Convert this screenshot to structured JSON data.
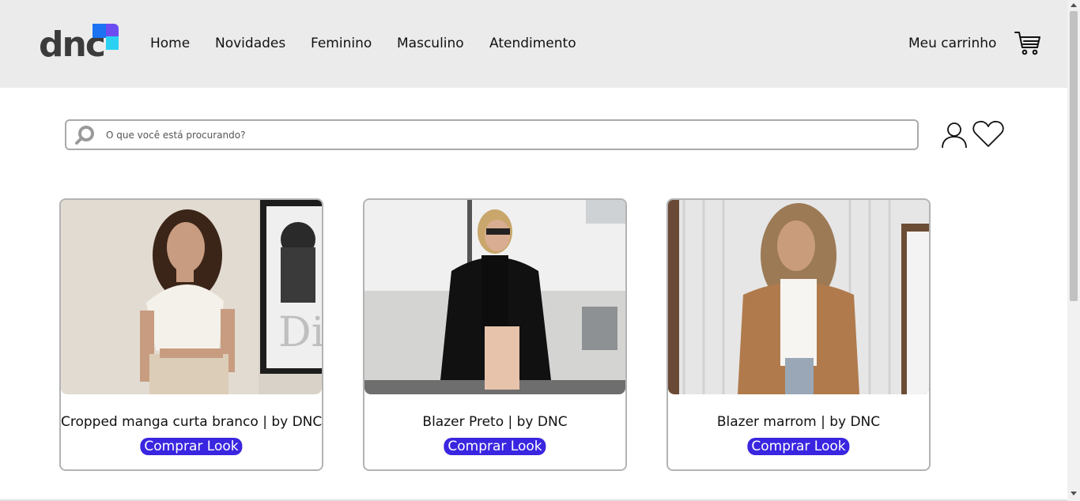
{
  "brand": {
    "logo_text": "dnc",
    "colors": {
      "blue": "#1b73f2",
      "purple": "#6d4df2",
      "cyan": "#2bd1f2"
    }
  },
  "nav": {
    "items": [
      {
        "label": "Home"
      },
      {
        "label": "Novidades"
      },
      {
        "label": "Feminino"
      },
      {
        "label": "Masculino"
      },
      {
        "label": "Atendimento"
      }
    ]
  },
  "cart": {
    "label": "Meu carrinho",
    "icon": "cart-icon"
  },
  "search": {
    "placeholder": "O que você está procurando?",
    "value": "",
    "icon": "search-icon"
  },
  "actions": {
    "user_icon": "user-icon",
    "favorites_icon": "heart-icon"
  },
  "products": [
    {
      "title": "Cropped manga curta branco | by DNC",
      "button_label": "Comprar Look"
    },
    {
      "title": "Blazer Preto | by DNC",
      "button_label": "Comprar Look"
    },
    {
      "title": "Blazer marrom | by DNC",
      "button_label": "Comprar Look"
    }
  ],
  "theme": {
    "accent": "#3a25e0",
    "header_bg": "#ebebeb"
  }
}
